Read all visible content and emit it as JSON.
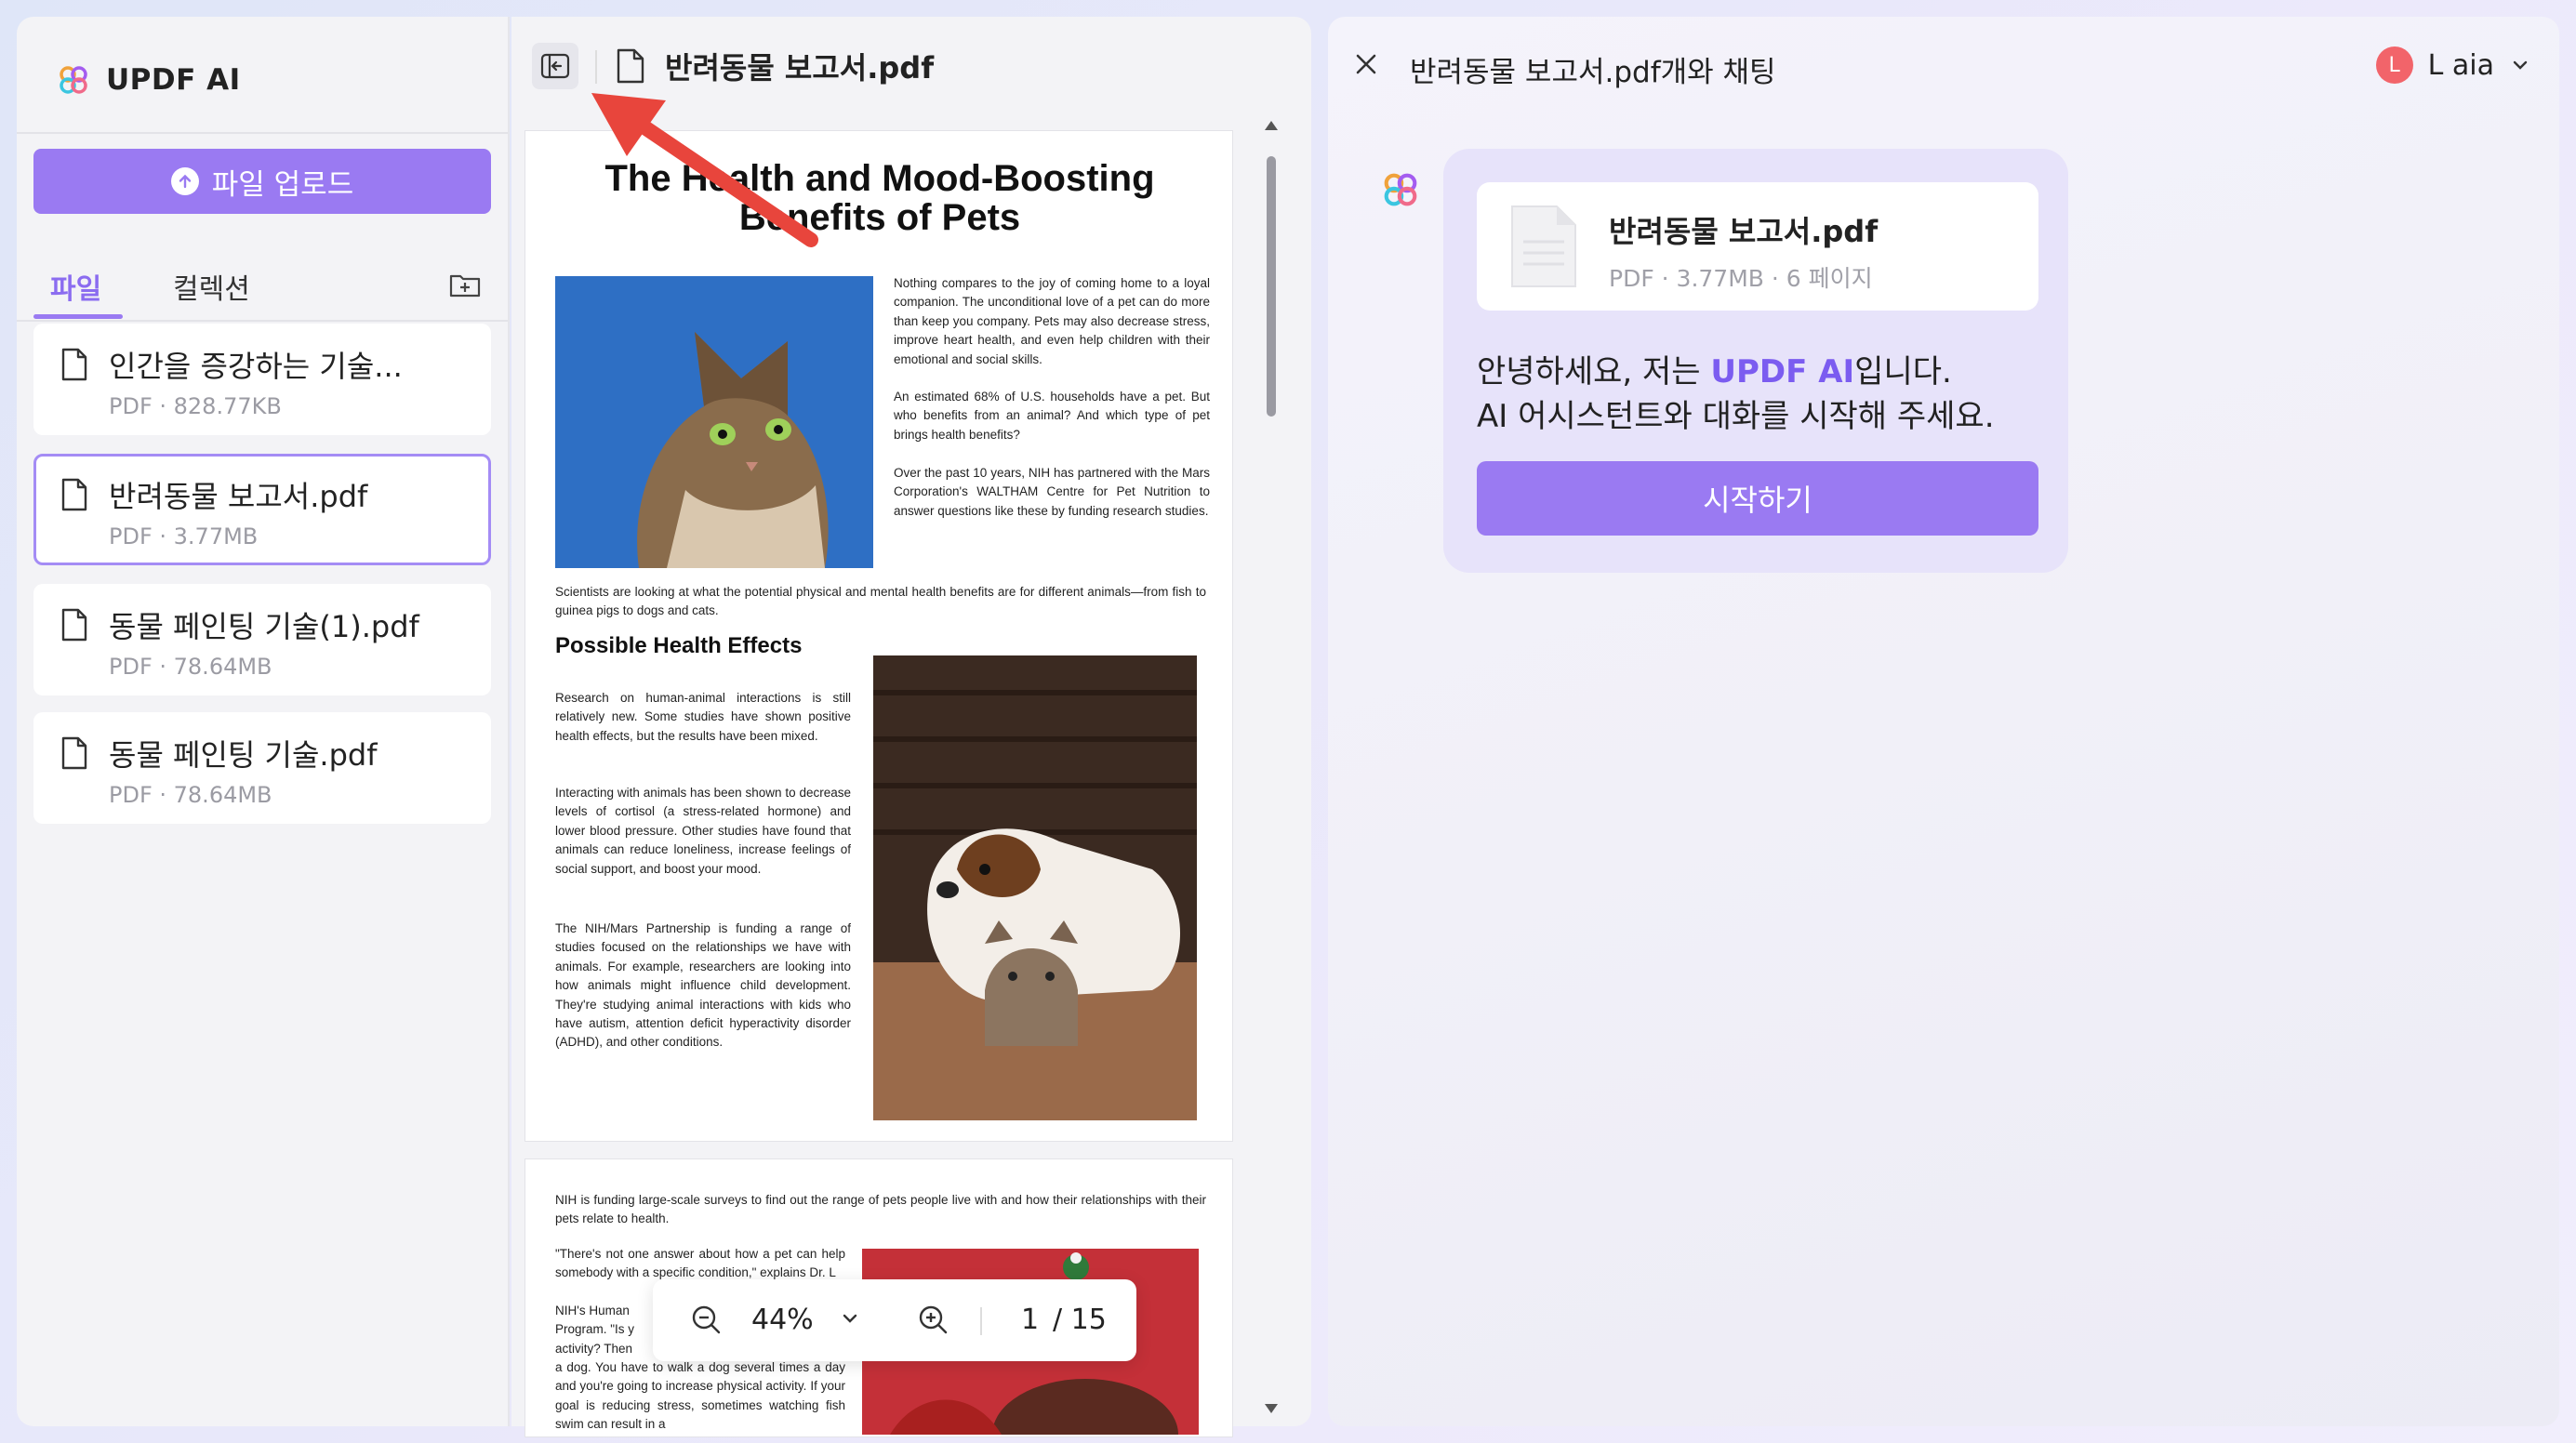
{
  "sidebar": {
    "brand": "UPDF AI",
    "upload_label": "파일 업로드",
    "tabs": [
      "파일",
      "컬렉션"
    ],
    "files": [
      {
        "name": "인간을 증강하는 기술...",
        "meta": "PDF · 828.77KB"
      },
      {
        "name": "반려동물 보고서.pdf",
        "meta": "PDF · 3.77MB"
      },
      {
        "name": "동물 페인팅 기술(1).pdf",
        "meta": "PDF · 78.64MB"
      },
      {
        "name": "동물 페인팅 기술.pdf",
        "meta": "PDF · 78.64MB"
      }
    ],
    "selected_index": 1
  },
  "viewer": {
    "title": "반려동물 보고서.pdf",
    "zoom": "44%",
    "page_current": "1",
    "page_total": "/ 15",
    "page1": {
      "title_line1": "The Health and Mood-Boosting",
      "title_line2": "Benefits of Pets",
      "intro1": "Nothing compares to the joy of coming home to a loyal companion. The unconditional love of a pet can do more than keep you company. Pets may also decrease stress, improve heart health, and even help children with their emotional and social skills.",
      "intro2": "An estimated 68% of U.S. households have a pet. But who benefits from an animal? And which type of pet brings health benefits?",
      "intro3": "Over the past 10 years, NIH has partnered with the Mars Corporation's WALTHAM Centre for Pet Nutrition to answer questions like these by funding research studies.",
      "wide": "Scientists are looking at what the potential physical and mental health benefits are for different animals—from fish to guinea pigs to dogs and cats.",
      "heading": "Possible Health Effects",
      "para1": "Research on human-animal interactions is still relatively new. Some studies have shown positive health effects, but the results have been mixed.",
      "para2": "Interacting with animals has been shown to decrease levels of cortisol (a stress-related hormone) and lower blood pressure. Other studies have found that animals can reduce loneliness, increase feelings of social support, and boost your mood.",
      "para3": "The NIH/Mars Partnership is funding a range of studies focused on the relationships we have with animals. For example, researchers are looking into how animals might influence child development. They're studying animal interactions with kids who have autism, attention deficit hyperactivity disorder (ADHD), and other conditions."
    },
    "page2": {
      "wide": "NIH is funding large-scale surveys to find out the range of pets people live with and how their relationships with their pets relate to health.",
      "quote_top": "\"There's not one answer about how a pet can help somebody with a specific condition,\" explains Dr. L",
      "quote_lines": [
        "NIH's Human",
        "Program. \"Is y",
        "activity? Then"
      ],
      "quote_bottom": "a dog. You have to walk a dog several times a day and you're going to increase physical activity. If your goal is reducing stress, sometimes watching fish swim can result in a"
    }
  },
  "chat": {
    "title": "반려동물 보고서.pdf개와 채팅",
    "user_initial": "L",
    "user_name": "L aia",
    "file_name": "반려동물 보고서.pdf",
    "file_meta": "PDF · 3.77MB · 6 페이지",
    "greeting_prefix": "안녕하세요, 저는 ",
    "greeting_brand": "UPDF AI",
    "greeting_suffix": "입니다.",
    "greeting_line2": "AI 어시스턴트와 대화를 시작해 주세요.",
    "start_label": "시작하기"
  },
  "colors": {
    "accent": "#9a7af2",
    "brand_text": "#7b5cf0",
    "annotation_arrow": "#e8453c"
  }
}
